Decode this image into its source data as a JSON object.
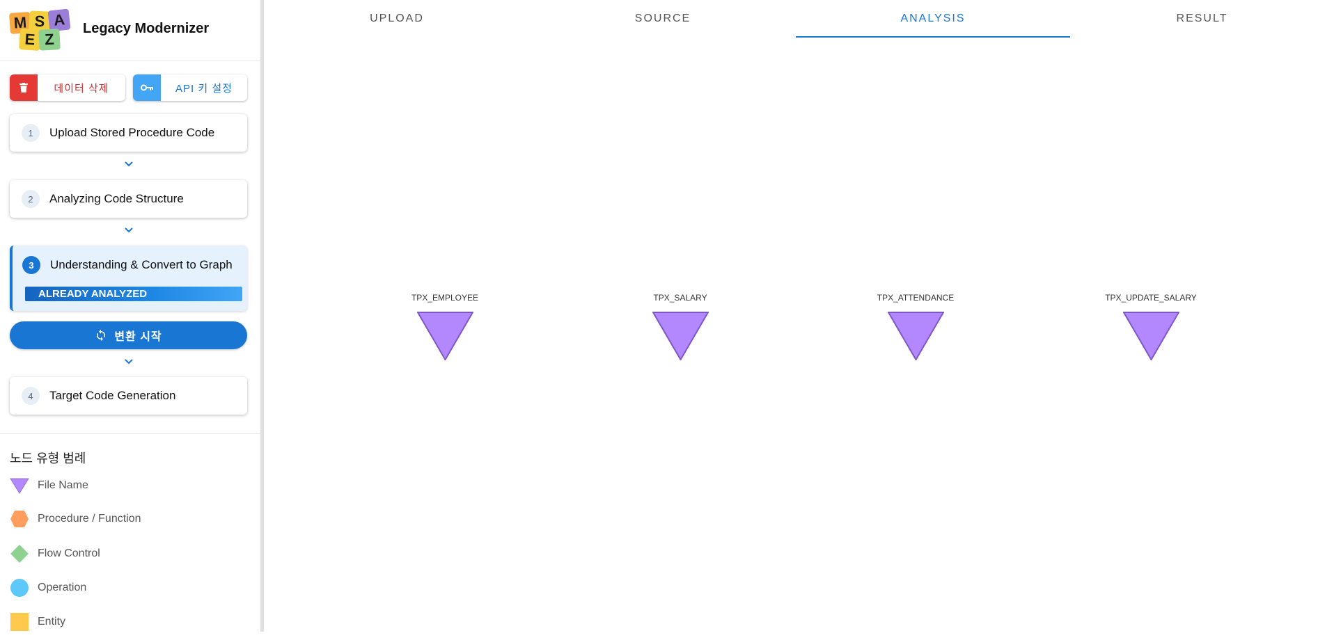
{
  "app": {
    "title": "Legacy Modernizer",
    "logo_letters": [
      "M",
      "S",
      "A",
      "E",
      "Z"
    ]
  },
  "actions": {
    "delete_data_label": "데이터 삭제",
    "api_key_label": "API 키 설정"
  },
  "steps": [
    {
      "number": "1",
      "label": "Upload Stored Procedure Code",
      "active": false
    },
    {
      "number": "2",
      "label": "Analyzing Code Structure",
      "active": false
    },
    {
      "number": "3",
      "label": "Understanding & Convert to Graph",
      "active": true,
      "badge": "ALREADY ANALYZED"
    },
    {
      "number": "4",
      "label": "Target Code Generation",
      "active": false
    }
  ],
  "convert_button": {
    "label": "변환 시작",
    "icon": "sync-icon"
  },
  "legend": {
    "title": "노드 유형 범례",
    "items": [
      {
        "label": "File Name",
        "shape": "triangle-down",
        "color": "#b388ff"
      },
      {
        "label": "Procedure / Function",
        "shape": "hexagon",
        "color": "#ff9e5e"
      },
      {
        "label": "Flow Control",
        "shape": "diamond",
        "color": "#8fd18f"
      },
      {
        "label": "Operation",
        "shape": "circle",
        "color": "#5fc8fb"
      },
      {
        "label": "Entity",
        "shape": "square",
        "color": "#ffc94d"
      }
    ]
  },
  "tabs": [
    {
      "label": "UPLOAD",
      "active": false
    },
    {
      "label": "SOURCE",
      "active": false
    },
    {
      "label": "ANALYSIS",
      "active": true
    },
    {
      "label": "RESULT",
      "active": false
    }
  ],
  "graph": {
    "nodes": [
      {
        "label": "TPX_EMPLOYEE",
        "type": "File Name"
      },
      {
        "label": "TPX_SALARY",
        "type": "File Name"
      },
      {
        "label": "TPX_ATTENDANCE",
        "type": "File Name"
      },
      {
        "label": "TPX_UPDATE_SALARY",
        "type": "File Name"
      }
    ]
  },
  "colors": {
    "primary": "#1976d2",
    "danger": "#e53935",
    "api_key": "#42a5f5",
    "file_node_fill": "#b388ff",
    "file_node_stroke": "#7e57c2"
  }
}
